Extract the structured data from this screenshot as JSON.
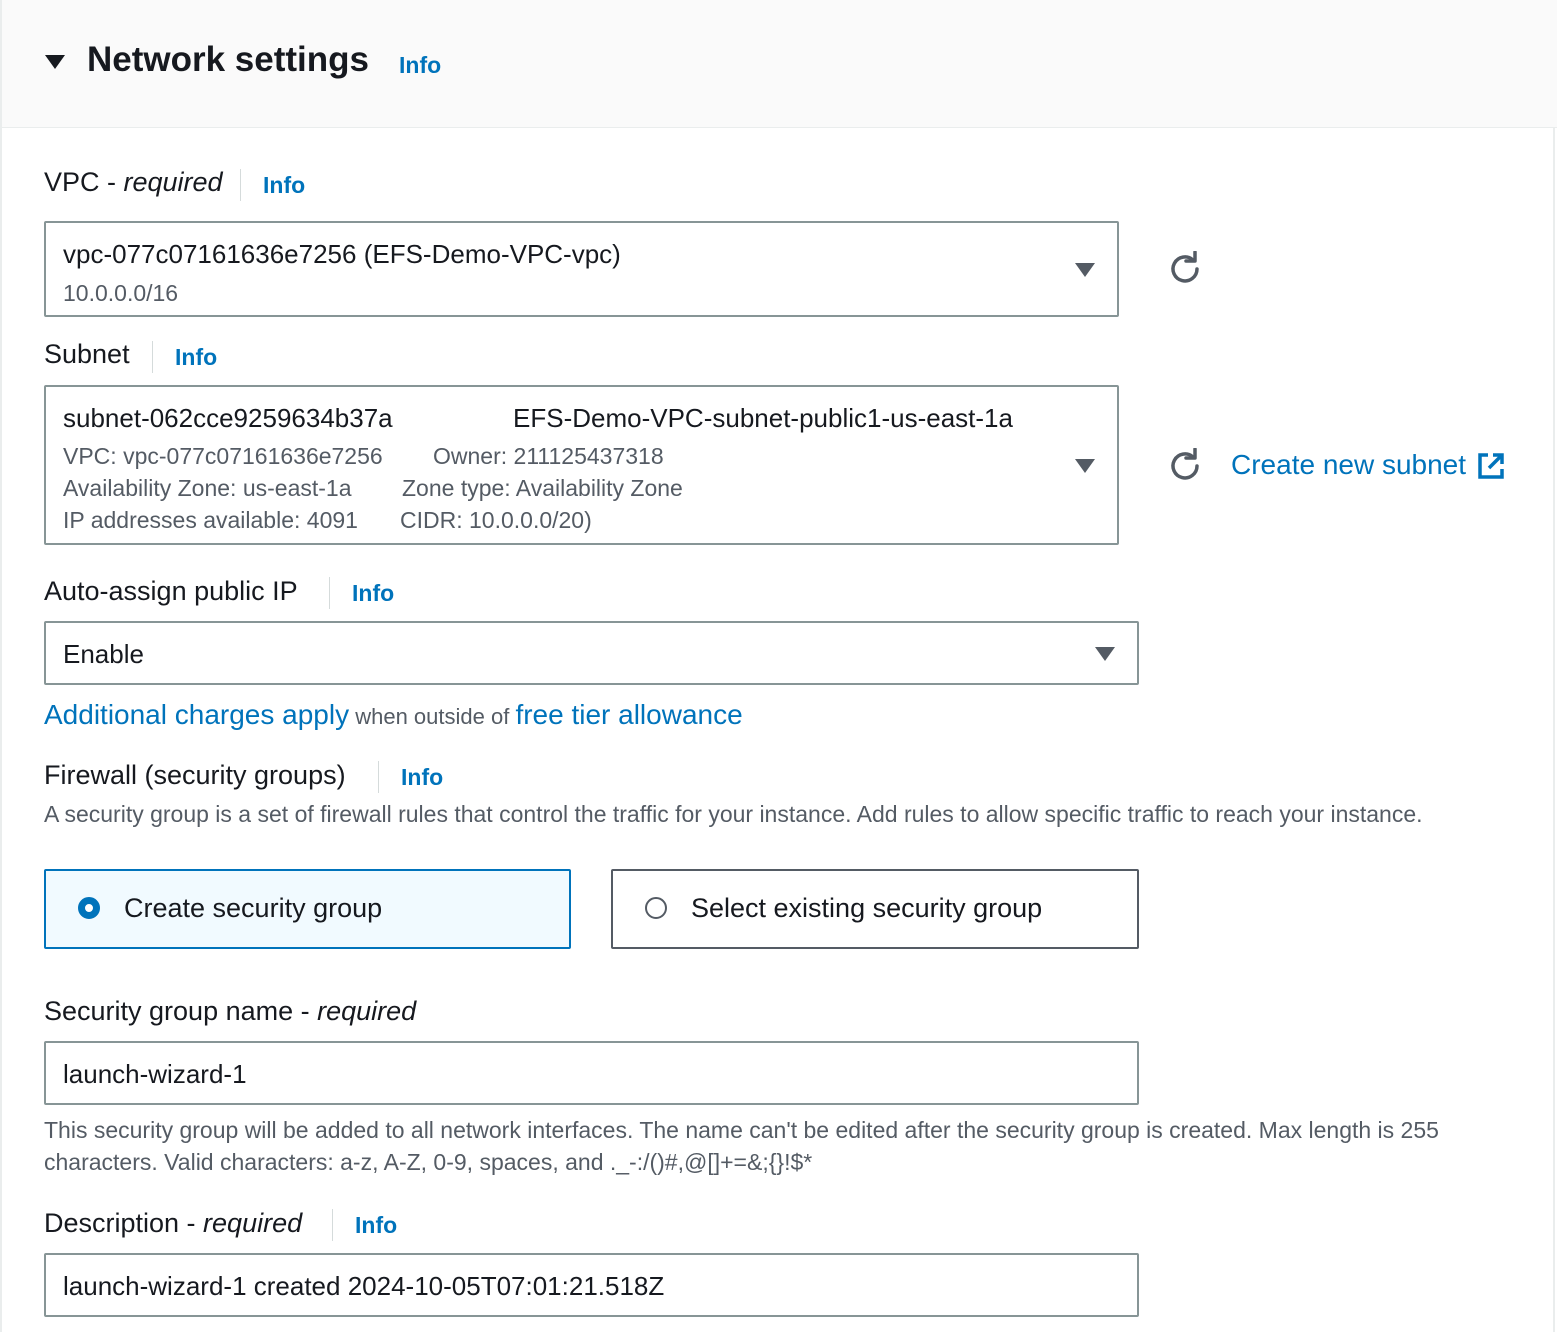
{
  "section": {
    "title": "Network settings",
    "info": "Info"
  },
  "vpc": {
    "label": "VPC - ",
    "label_required": "required",
    "info": "Info",
    "selected_primary": "vpc-077c07161636e7256 (EFS-Demo-VPC-vpc)",
    "selected_secondary": "10.0.0.0/16"
  },
  "subnet": {
    "label": "Subnet",
    "info": "Info",
    "selected_id": "subnet-062cce9259634b37a",
    "selected_name": "EFS-Demo-VPC-subnet-public1-us-east-1a",
    "vpc": "VPC: vpc-077c07161636e7256",
    "owner": "Owner: 211125437318",
    "az": "Availability Zone: us-east-1a",
    "zone_type": "Zone type: Availability Zone",
    "ips": "IP addresses available: 4091",
    "cidr": "CIDR: 10.0.0.0/20)",
    "create_link": "Create new subnet"
  },
  "auto_ip": {
    "label": "Auto-assign public IP",
    "info": "Info",
    "value": "Enable",
    "charges_link": "Additional charges apply",
    "charges_mid": " when outside of ",
    "free_tier_link": "free tier allowance"
  },
  "firewall": {
    "label": "Firewall (security groups)",
    "info": "Info",
    "description": "A security group is a set of firewall rules that control the traffic for your instance. Add rules to allow specific traffic to reach your instance.",
    "option_create": "Create security group",
    "option_select": "Select existing security group"
  },
  "sg_name": {
    "label": "Security group name - ",
    "label_required": "required",
    "value": "launch-wizard-1",
    "help": "This security group will be added to all network interfaces. The name can't be edited after the security group is created. Max length is 255 characters. Valid characters: a-z, A-Z, 0-9, spaces, and ._-:/()#,@[]+=&;{}!$*"
  },
  "sg_desc": {
    "label": "Description - ",
    "label_required": "required",
    "info": "Info",
    "value": "launch-wizard-1 created 2024-10-05T07:01:21.518Z"
  },
  "icons": {
    "caret": "caret-down-icon",
    "refresh": "refresh-icon",
    "external": "external-link-icon",
    "dropdown": "dropdown-arrow-icon"
  },
  "colors": {
    "link": "#0073bb",
    "text": "#16191f",
    "secondary_text": "#545b64",
    "selected_tile_bg": "#f1faff",
    "header_bg": "#fafafa"
  }
}
